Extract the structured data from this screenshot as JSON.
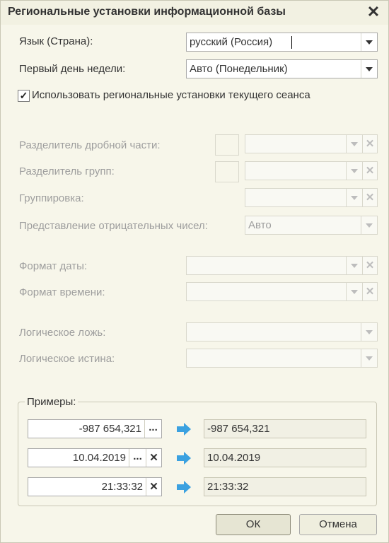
{
  "window": {
    "title": "Региональные установки информационной базы",
    "close_symbol": "✕"
  },
  "language": {
    "label": "Язык (Страна):",
    "value": "русский (Россия)"
  },
  "first_day": {
    "label": "Первый день недели:",
    "value": "Авто (Понедельник)"
  },
  "use_session": {
    "label": "Использовать региональные установки текущего сеанса",
    "checked": true
  },
  "decimal_sep": {
    "label": "Разделитель дробной части:"
  },
  "group_sep": {
    "label": "Разделитель групп:"
  },
  "grouping": {
    "label": "Группировка:"
  },
  "negative": {
    "label": "Представление отрицательных чисел:",
    "value": "Авто"
  },
  "date_format": {
    "label": "Формат даты:"
  },
  "time_format": {
    "label": "Формат времени:"
  },
  "bool_false": {
    "label": "Логическое ложь:"
  },
  "bool_true": {
    "label": "Логическое истина:"
  },
  "examples": {
    "title": "Примеры:",
    "rows": [
      {
        "input": "-987 654,321",
        "output": "-987 654,321"
      },
      {
        "input": "10.04.2019",
        "output": "10.04.2019"
      },
      {
        "input": "21:33:32",
        "output": "21:33:32"
      }
    ]
  },
  "buttons": {
    "ok": "ОК",
    "cancel": "Отмена"
  },
  "symbols": {
    "ellipsis": "...",
    "clear": "✕"
  },
  "colors": {
    "arrow": "#3ba1e0"
  }
}
